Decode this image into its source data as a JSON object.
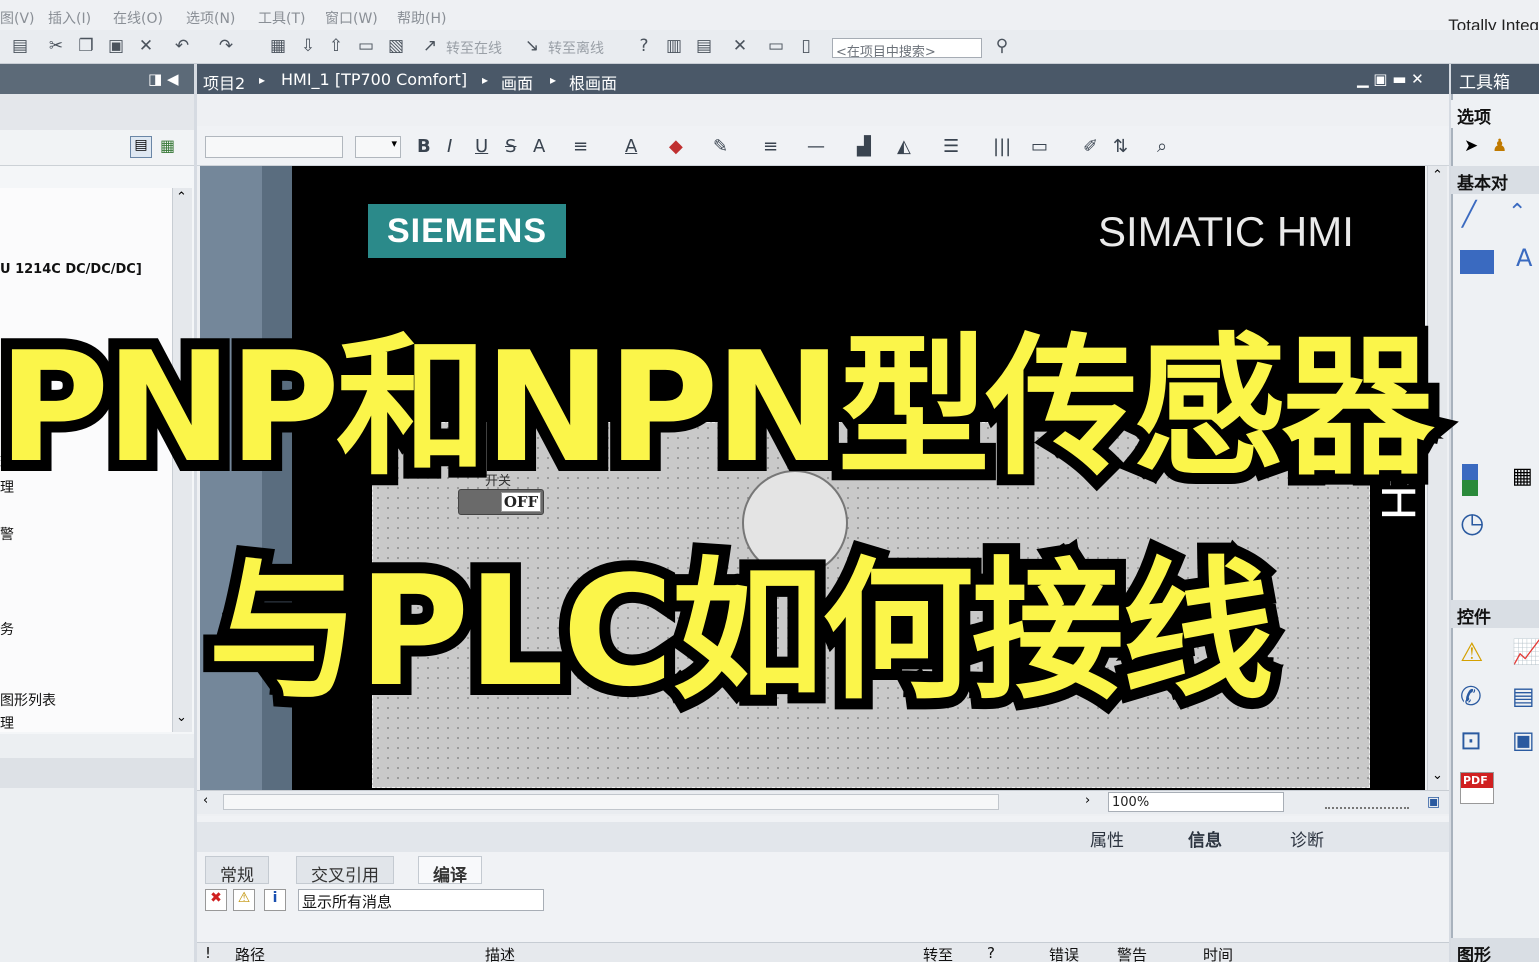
{
  "menu": {
    "items": [
      "图(V)",
      "插入(I)",
      "在线(O)",
      "选项(N)",
      "工具(T)",
      "窗口(W)",
      "帮助(H)"
    ],
    "brand": "Totally Integ"
  },
  "toolbar": {
    "go_online": "转至在线",
    "go_offline": "转至离线",
    "search_placeholder": "<在项目中搜索>"
  },
  "project_tree": {
    "items": [
      "U 1214C DC/DC/DC]",
      "理",
      "理",
      "警",
      "务",
      "图形列表",
      "理"
    ]
  },
  "breadcrumb": {
    "project": "项目2",
    "device": "HMI_1 [TP700 Comfort]",
    "screens": "画面",
    "screen": "根画面"
  },
  "hmi_screen": {
    "brand_logo": "SIEMENS",
    "product": "SIMATIC HMI",
    "switch_label": "开关",
    "switch_state": "OFF",
    "touch_text": "UCH"
  },
  "zoom": {
    "level": "100%"
  },
  "inspector": {
    "tabs": [
      "属性",
      "信息",
      "诊断"
    ],
    "subtabs": [
      "常规",
      "交叉引用",
      "编译"
    ],
    "filter": "显示所有消息",
    "columns": [
      "!",
      "路径",
      "描述",
      "转至",
      "?",
      "错误",
      "警告",
      "时间"
    ]
  },
  "toolbox": {
    "title": "工具箱",
    "options": "选项",
    "basic_objects": "基本对",
    "controls": "控件",
    "graphics": "图形"
  },
  "overlay": {
    "line1": "PNP和NPN型传感器",
    "line2": "与PLC如何接线"
  },
  "colors": {
    "overlay_text": "#fbf54a",
    "siemens_teal": "#2b8a8a",
    "header_bar": "#4a5868"
  }
}
